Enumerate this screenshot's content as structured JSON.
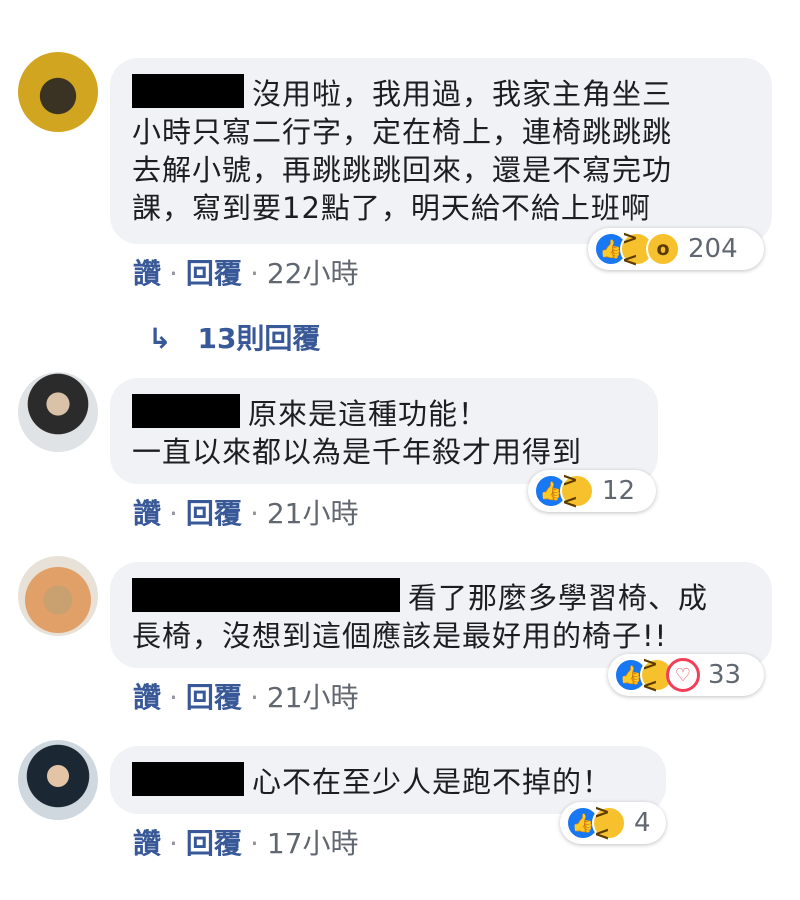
{
  "comments": [
    {
      "text": "沒用啦，我用過，我家主角坐三\n小時只寫二行字，定在椅上，連椅跳跳跳\n去解小號，再跳跳跳回來，還是不寫完功\n課，寫到要12點了，明天給不給上班啊",
      "reaction_count": "204",
      "like_label": "讚",
      "reply_label": "回覆",
      "time": "22小時"
    },
    {
      "text": "原來是這種功能！\n一直以來都以為是千年殺才用得到",
      "reaction_count": "12",
      "like_label": "讚",
      "reply_label": "回覆",
      "time": "21小時"
    },
    {
      "text": "看了那麼多學習椅、成\n長椅，沒想到這個應該是最好用的椅子!!",
      "reaction_count": "33",
      "like_label": "讚",
      "reply_label": "回覆",
      "time": "21小時"
    },
    {
      "text": "心不在至少人是跑不掉的！",
      "reaction_count": "4",
      "like_label": "讚",
      "reply_label": "回覆",
      "time": "17小時"
    }
  ],
  "replies_link": "13則回覆",
  "icons": {
    "reply_arrow": "reply-arrow-icon",
    "like": "like-icon",
    "haha": "haha-icon",
    "wow": "wow-icon",
    "love": "love-icon"
  },
  "colors": {
    "bubble": "#f0f2f5",
    "link": "#385898",
    "like_blue": "#1877f2"
  }
}
